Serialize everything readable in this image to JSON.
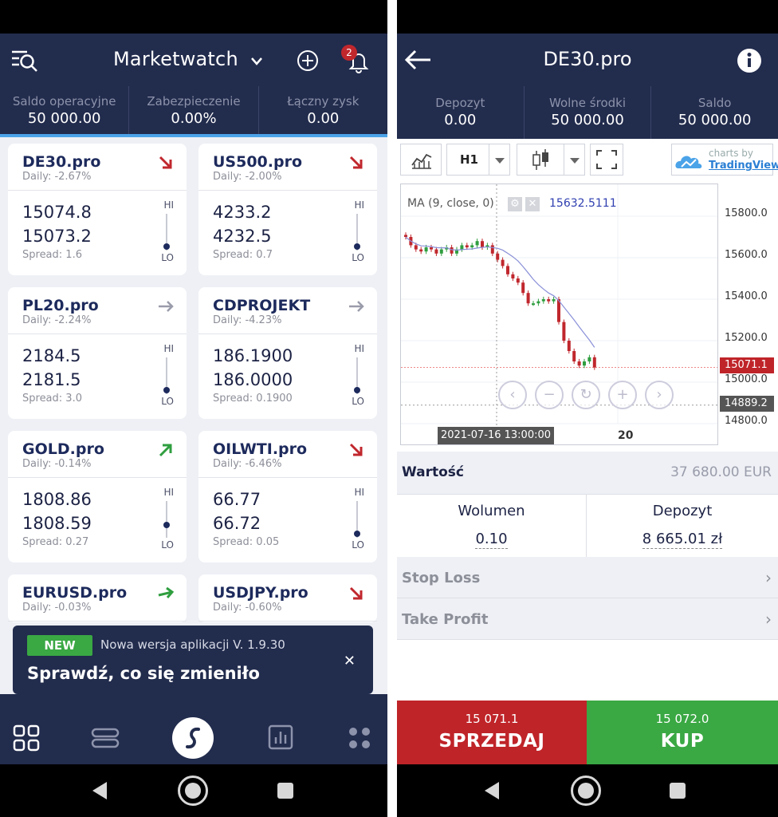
{
  "left": {
    "header": {
      "title": "Marketwatch",
      "notifications": "2"
    },
    "summary": [
      {
        "label": "Saldo operacyjne",
        "value": "50 000.00"
      },
      {
        "label": "Zabezpieczenie",
        "value": "0.00%"
      },
      {
        "label": "Łączny zysk",
        "value": "0.00"
      }
    ],
    "cards": [
      {
        "name": "DE30.pro",
        "daily": "Daily: -2.67%",
        "bid": "15074.8",
        "ask": "15073.2",
        "spread": "Spread: 1.6",
        "trend": "down",
        "level": 0.1
      },
      {
        "name": "US500.pro",
        "daily": "Daily: -2.00%",
        "bid": "4233.2",
        "ask": "4232.5",
        "spread": "Spread: 0.7",
        "trend": "down",
        "level": 0.1
      },
      {
        "name": "PL20.pro",
        "daily": "Daily: -2.24%",
        "bid": "2184.5",
        "ask": "2181.5",
        "spread": "Spread: 3.0",
        "trend": "flat",
        "level": 0.1
      },
      {
        "name": "CDPROJEKT",
        "daily": "Daily: -4.23%",
        "bid": "186.1900",
        "ask": "186.0000",
        "spread": "Spread: 0.1900",
        "trend": "flat",
        "level": 0.1
      },
      {
        "name": "GOLD.pro",
        "daily": "Daily: -0.14%",
        "bid": "1808.86",
        "ask": "1808.59",
        "spread": "Spread: 0.27",
        "trend": "up",
        "level": 0.35
      },
      {
        "name": "OILWTI.pro",
        "daily": "Daily: -6.46%",
        "bid": "66.77",
        "ask": "66.72",
        "spread": "Spread: 0.05",
        "trend": "down",
        "level": 0.1
      },
      {
        "name": "EURUSD.pro",
        "daily": "Daily: -0.03%",
        "trend": "up-strong"
      },
      {
        "name": "USDJPY.pro",
        "daily": "Daily: -0.60%",
        "trend": "down"
      }
    ],
    "hi_label": "HI",
    "lo_label": "LO",
    "toast": {
      "badge": "NEW",
      "version": "Nowa wersja aplikacji V. 1.9.30",
      "message": "Sprawdź, co się zmieniło"
    },
    "bottom_nav": [
      "grid-icon",
      "layers-icon",
      "brand-logo",
      "chart-icon",
      "more-icon"
    ]
  },
  "right": {
    "header": {
      "title": "DE30.pro"
    },
    "summary": [
      {
        "label": "Depozyt",
        "value": "0.00"
      },
      {
        "label": "Wolne środki",
        "value": "50 000.00"
      },
      {
        "label": "Saldo",
        "value": "50 000.00"
      }
    ],
    "toolbar": {
      "timeframe": "H1",
      "charts_by": "charts by",
      "brand": "TradingView"
    },
    "chart_data": {
      "type": "candlestick",
      "indicator_label": "MA (9, close, 0)",
      "indicator_value": "15632.5111",
      "y_ticks": [
        "15800.0",
        "15600.0",
        "15400.0",
        "15200.0",
        "15000.0",
        "14800.0"
      ],
      "ylim": [
        14800,
        15900
      ],
      "last_price": "15071.1",
      "crosshair_price": "14889.2",
      "crosshair_time": "2021-07-16 13:00:00",
      "x_tick": "20",
      "closes": [
        15700,
        15660,
        15640,
        15630,
        15650,
        15640,
        15620,
        15640,
        15650,
        15620,
        15640,
        15660,
        15650,
        15660,
        15680,
        15650,
        15660,
        15620,
        15590,
        15560,
        15520,
        15500,
        15480,
        15430,
        15380,
        15380,
        15390,
        15400,
        15390,
        15400,
        15290,
        15200,
        15150,
        15100,
        15080,
        15100,
        15120,
        15071
      ]
    },
    "value_row": {
      "label": "Wartość",
      "value": "37 680.00 EUR"
    },
    "volume": {
      "label": "Wolumen",
      "value": "0.10"
    },
    "deposit": {
      "label": "Depozyt",
      "value": "8 665.01 zł"
    },
    "stop_loss": "Stop Loss",
    "take_profit": "Take Profit",
    "sell": {
      "price": "15 071.1",
      "label": "SPRZEDAJ"
    },
    "buy": {
      "price": "15 072.0",
      "label": "KUP"
    },
    "colors": {
      "sell": "#bf2429",
      "buy": "#3aa843",
      "header": "#222c4d"
    }
  }
}
